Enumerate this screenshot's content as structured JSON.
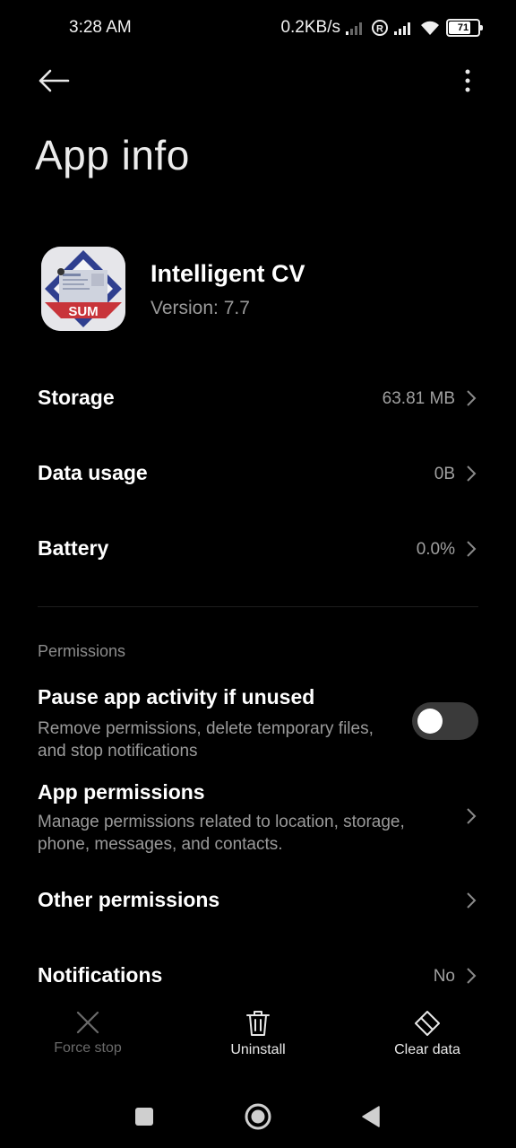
{
  "status_bar": {
    "time": "3:28 AM",
    "net_speed": "0.2KB/s",
    "battery_level": "71"
  },
  "header": {
    "title": "App info"
  },
  "app": {
    "name": "Intelligent CV",
    "version": "Version: 7.7",
    "icon_text": "SUM"
  },
  "rows": [
    {
      "label": "Storage",
      "value": "63.81 MB"
    },
    {
      "label": "Data usage",
      "value": "0B"
    },
    {
      "label": "Battery",
      "value": "0.0%"
    }
  ],
  "permissions": {
    "section_label": "Permissions",
    "pause": {
      "title": "Pause app activity if unused",
      "desc": "Remove permissions, delete temporary files, and stop notifications",
      "enabled": false
    },
    "app_permissions": {
      "title": "App permissions",
      "desc": "Manage permissions related to location, storage, phone, messages, and contacts."
    },
    "other": {
      "title": "Other permissions"
    },
    "notifications": {
      "title": "Notifications",
      "value": "No"
    }
  },
  "actions": {
    "force_stop": "Force stop",
    "uninstall": "Uninstall",
    "clear_data": "Clear data"
  },
  "colors": {
    "background": "#000000",
    "text_primary": "#ffffff",
    "text_secondary": "#9a9a9a",
    "toggle_off": "#3a3a3a",
    "disabled": "#6a6a6a"
  }
}
